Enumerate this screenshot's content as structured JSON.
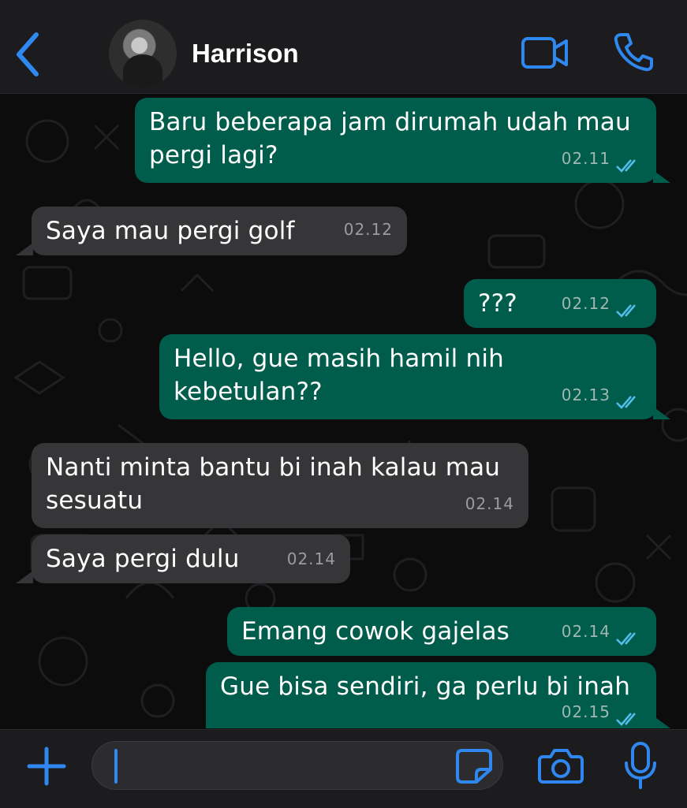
{
  "header": {
    "contact_name": "Harrison",
    "back_icon": "chevron-left-icon",
    "video_icon": "video-camera-icon",
    "call_icon": "phone-icon"
  },
  "messages": [
    {
      "direction": "outgoing",
      "lines": [
        "Baru beberapa jam dirumah udah mau",
        "pergi lagi?"
      ],
      "time": "02.11",
      "read": true
    },
    {
      "direction": "incoming",
      "lines": [
        "Saya mau pergi golf"
      ],
      "time": "02.12"
    },
    {
      "direction": "outgoing",
      "lines": [
        "???"
      ],
      "time": "02.12",
      "read": true
    },
    {
      "direction": "outgoing",
      "lines": [
        "Hello, gue masih hamil nih",
        "kebetulan??"
      ],
      "time": "02.13",
      "read": true
    },
    {
      "direction": "incoming",
      "lines": [
        "Nanti minta bantu bi inah kalau mau",
        "sesuatu"
      ],
      "time": "02.14"
    },
    {
      "direction": "incoming",
      "lines": [
        "Saya pergi dulu"
      ],
      "time": "02.14"
    },
    {
      "direction": "outgoing",
      "lines": [
        "Emang cowok gajelas"
      ],
      "time": "02.14",
      "read": true
    },
    {
      "direction": "outgoing",
      "lines": [
        "Gue bisa sendiri, ga perlu bi inah"
      ],
      "time": "02.15",
      "read": true
    }
  ],
  "composer": {
    "input_value": "",
    "plus_icon": "plus-icon",
    "sticker_icon": "sticker-icon",
    "camera_icon": "camera-icon",
    "mic_icon": "microphone-icon"
  },
  "colors": {
    "accent": "#2f87f0",
    "outgoing_bubble": "#005c4b",
    "incoming_bubble": "#363638",
    "read_ticks": "#53bdeb"
  }
}
